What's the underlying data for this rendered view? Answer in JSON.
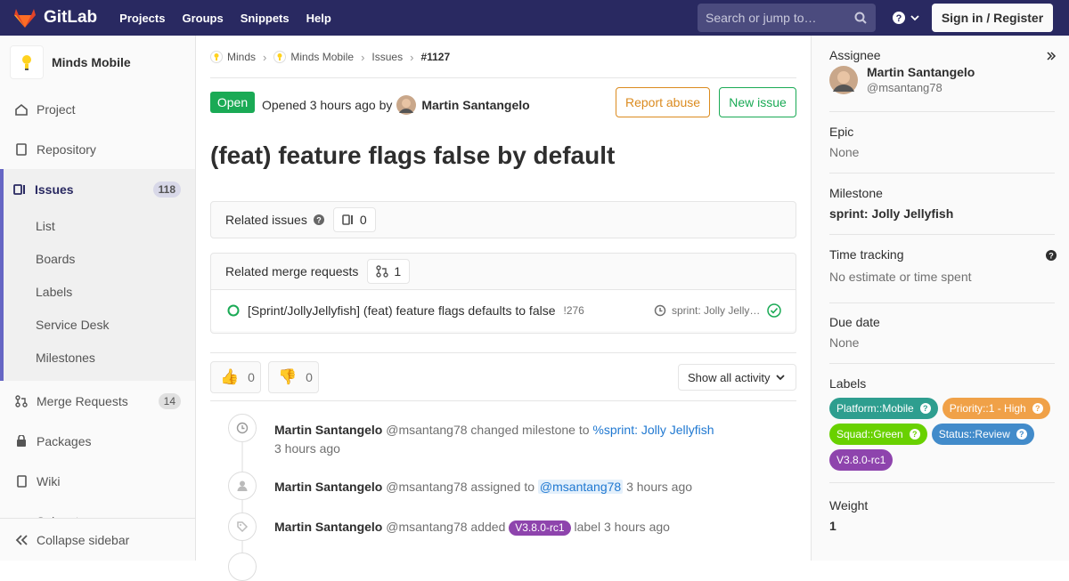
{
  "topbar": {
    "brand": "GitLab",
    "nav": [
      "Projects",
      "Groups",
      "Snippets",
      "Help"
    ],
    "search_placeholder": "Search or jump to…",
    "signin_label": "Sign in / Register"
  },
  "sidebar": {
    "project_name": "Minds Mobile",
    "items": [
      {
        "label": "Project",
        "icon": "home-icon"
      },
      {
        "label": "Repository",
        "icon": "doc-icon"
      }
    ],
    "issues": {
      "label": "Issues",
      "count": "118",
      "sub": [
        "List",
        "Boards",
        "Labels",
        "Service Desk",
        "Milestones"
      ]
    },
    "after": [
      {
        "label": "Merge Requests",
        "count": "14",
        "icon": "merge-request-icon"
      },
      {
        "label": "Packages",
        "icon": "package-icon"
      },
      {
        "label": "Wiki",
        "icon": "book-icon"
      },
      {
        "label": "Snippets",
        "icon": "snippet-icon"
      }
    ],
    "collapse_label": "Collapse sidebar"
  },
  "breadcrumb": [
    "Minds",
    "Minds Mobile",
    "Issues",
    "#1127"
  ],
  "issue": {
    "status": "Open",
    "opened_text": "Opened",
    "opened_time": "3 hours ago",
    "by": "by",
    "author": "Martin Santangelo",
    "report_label": "Report abuse",
    "new_issue_label": "New issue",
    "title": "(feat) feature flags false by default"
  },
  "related_issues": {
    "label": "Related issues",
    "count": "0"
  },
  "related_mrs": {
    "label": "Related merge requests",
    "count": "1",
    "items": [
      {
        "title": "[Sprint/JollyJellyfish] (feat) feature flags defaults to false",
        "ref": "!276",
        "milestone": "sprint: Jolly Jelly…"
      }
    ]
  },
  "awards": {
    "thumbsup": "0",
    "thumbsdown": "0"
  },
  "activity_filter": "Show all activity",
  "notes": [
    {
      "author": "Martin Santangelo",
      "handle": "@msantang78",
      "action": "changed milestone to",
      "link": "%sprint: Jolly Jellyfish",
      "time": "3 hours ago"
    },
    {
      "author": "Martin Santangelo",
      "handle": "@msantang78",
      "action": "assigned to",
      "mention": "@msantang78",
      "time": "3 hours ago"
    },
    {
      "author": "Martin Santangelo",
      "handle": "@msantang78",
      "action": "added",
      "label": "V3.8.0-rc1",
      "after": "label",
      "time": "3 hours ago"
    }
  ],
  "right_sidebar": {
    "assignee": {
      "label": "Assignee",
      "name": "Martin Santangelo",
      "handle": "@msantang78"
    },
    "epic": {
      "label": "Epic",
      "value": "None"
    },
    "milestone": {
      "label": "Milestone",
      "value": "sprint: Jolly Jellyfish"
    },
    "time_tracking": {
      "label": "Time tracking",
      "value": "No estimate or time spent"
    },
    "due_date": {
      "label": "Due date",
      "value": "None"
    },
    "labels_title": "Labels",
    "labels": [
      {
        "text": "Platform::Mobile",
        "color": "#2e9e8f",
        "scoped": true
      },
      {
        "text": "Priority::1 - High",
        "color": "#f0a148",
        "scoped": true
      },
      {
        "text": "Squad::Green",
        "color": "#69d100",
        "scoped": true
      },
      {
        "text": "Status::Review",
        "color": "#428bca",
        "scoped": true
      },
      {
        "text": "V3.8.0-rc1",
        "color": "#8e44ad",
        "scoped": false
      }
    ],
    "weight": {
      "label": "Weight",
      "value": "1"
    }
  },
  "colors": {
    "header": "#292961",
    "open": "#1aaa55",
    "report": "#db8b1f",
    "link": "#1f78d1"
  }
}
